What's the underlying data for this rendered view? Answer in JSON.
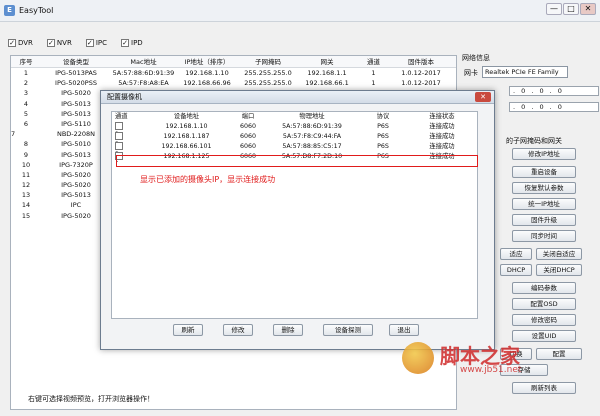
{
  "app": {
    "title": "EasyTool",
    "min": "—",
    "max": "□",
    "close": "✕"
  },
  "filters": [
    {
      "label": "DVR",
      "checked": true
    },
    {
      "label": "NVR",
      "checked": true
    },
    {
      "label": "IPC",
      "checked": true
    },
    {
      "label": "IPD",
      "checked": true
    }
  ],
  "device_table": {
    "headers": [
      "序号",
      "设备类型",
      "Mac地址",
      "IP地址（排序）",
      "子网掩码",
      "网关",
      "通道",
      "固件版本"
    ],
    "rows": [
      [
        "1",
        "IPG-5013PAS",
        "5A:57:88:6D:91:39",
        "192.168.1.10",
        "255.255.255.0",
        "192.168.1.1",
        "1",
        "1.0.12-2017"
      ],
      [
        "2",
        "IPG-5020PSS",
        "5A:57:F8:A8:EA",
        "192.168.66.96",
        "255.255.255.0",
        "192.168.66.1",
        "1",
        "1.0.12-2017"
      ],
      [
        "3",
        "IPG-5020",
        "",
        "",
        "",
        "",
        "",
        ""
      ],
      [
        "4",
        "IPG-5013",
        "",
        "",
        "",
        "",
        "",
        ""
      ],
      [
        "5",
        "IPG-5013",
        "",
        "",
        "",
        "",
        "",
        ""
      ],
      [
        "6",
        "IPG-5110",
        "",
        "",
        "",
        "",
        "",
        ""
      ],
      [
        "7",
        "NBD-2208N",
        "",
        "",
        "",
        "",
        "",
        ""
      ],
      [
        "8",
        "IPG-5010",
        "",
        "",
        "",
        "",
        "",
        ""
      ],
      [
        "9",
        "IPG-5013",
        "",
        "",
        "",
        "",
        "",
        ""
      ],
      [
        "10",
        "IPG-7320P",
        "",
        "",
        "",
        "",
        "",
        ""
      ],
      [
        "11",
        "IPG-5020",
        "",
        "",
        "",
        "",
        "",
        ""
      ],
      [
        "12",
        "IPG-5020",
        "",
        "",
        "",
        "",
        "",
        ""
      ],
      [
        "13",
        "IPG-5013",
        "",
        "",
        "",
        "",
        "",
        ""
      ],
      [
        "14",
        "IPC",
        "",
        "",
        "",
        "",
        "",
        ""
      ],
      [
        "15",
        "IPG-5020",
        "",
        "",
        "",
        "",
        "",
        ""
      ]
    ],
    "checked_row": "7"
  },
  "right_panel": {
    "section": "网络信息",
    "nic_label": "网卡",
    "nic_value": "Realtek PCIe FE Family",
    "ip_value": ". 0 . 0 . 0",
    "mask_value": ". 0 . 0 . 0",
    "same_subnet_title": "的子网掩码和网关",
    "buttons": [
      "修改IP地址",
      "重启设备",
      "恢复默认参数",
      "统一IP地址",
      "固件升级",
      "同步时间",
      "适应",
      "关闭自适应",
      "DHCP",
      "关闭DHCP",
      "编码参数",
      "配置OSD",
      "修改密码",
      "设置UID",
      "切换",
      "配置",
      "存储",
      "刷新列表"
    ]
  },
  "status": "右键可选择视频预览，打开浏览器操作！",
  "dialog": {
    "title": "配置摄像机",
    "close": "✕",
    "headers": [
      "通道",
      "设备地址",
      "端口",
      "物理地址",
      "协议",
      "连接状态"
    ],
    "rows": [
      [
        "1",
        "192.168.1.10",
        "6060",
        "5A:57:88:6D:91:39",
        "P6S",
        "连接成功"
      ],
      [
        "2",
        "192.168.1.187",
        "6060",
        "5A:57:F8:C9:44:FA",
        "P6S",
        "连接成功"
      ],
      [
        "3",
        "192.168.66.101",
        "6060",
        "5A:57:88:85:C5:17",
        "P6S",
        "连接成功"
      ],
      [
        "4",
        "192.168.1.125",
        "6060",
        "5A:57:D8:F7:2D:10",
        "P6S",
        "连接成功"
      ]
    ],
    "annotation": "显示已添加的摄像头IP，显示连接成功",
    "buttons": [
      "刷新",
      "修改",
      "删除",
      "设备探测",
      "退出"
    ]
  },
  "watermark": {
    "text": "脚本之家",
    "url": "www.jb51.net"
  }
}
